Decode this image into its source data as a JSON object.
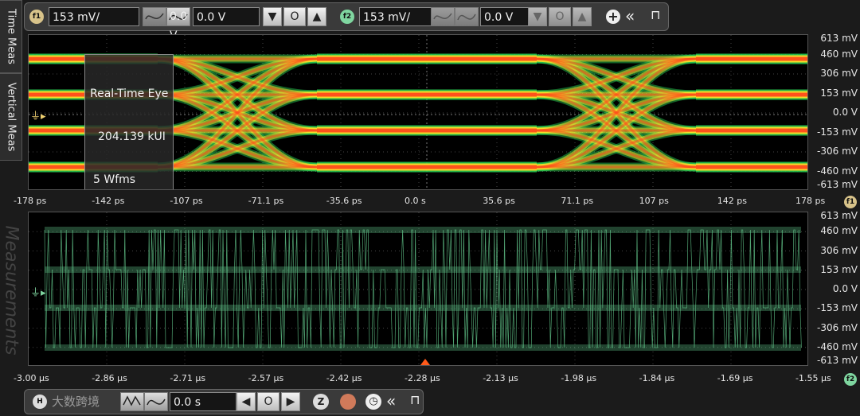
{
  "side_tabs": {
    "time_meas": "Time Meas",
    "vertical_meas": "Vertical Meas",
    "measurements": "Measurements"
  },
  "toolbar": {
    "f1": {
      "badge": "f1",
      "scale": "153 mV/",
      "offset": "0.0 V"
    },
    "f2": {
      "badge": "f2",
      "scale": "153 mV/",
      "offset": "0.0 V"
    },
    "add_icon": "plus-circle-icon",
    "collapse_icon": "double-chevron-left-icon",
    "pin_icon": "pin-icon"
  },
  "eye": {
    "overlay_title": "Real-Time Eye",
    "overlay_rate": "204.139 kUI",
    "overlay_wfms": "5 Wfms",
    "x_ticks": [
      "-178 ps",
      "-142 ps",
      "-107 ps",
      "-71.1 ps",
      "-35.6 ps",
      "0.0 s",
      "35.6 ps",
      "71.1 ps",
      "107 ps",
      "142 ps",
      "178 ps"
    ],
    "y_ticks": [
      "613 mV",
      "460 mV",
      "306 mV",
      "153 mV",
      "0.0 V",
      "-153 mV",
      "-306 mV",
      "-460 mV",
      "-613 mV"
    ],
    "axis_badge": "f1"
  },
  "waveform": {
    "x_ticks": [
      "-3.00 µs",
      "-2.86 µs",
      "-2.71 µs",
      "-2.57 µs",
      "-2.42 µs",
      "-2.28 µs",
      "-2.13 µs",
      "-1.98 µs",
      "-1.84 µs",
      "-1.69 µs",
      "-1.55 µs"
    ],
    "y_ticks": [
      "613 mV",
      "460 mV",
      "306 mV",
      "153 mV",
      "0.0 V",
      "-153 mV",
      "-306 mV",
      "-460 mV",
      "-613 mV"
    ],
    "axis_badge": "f2",
    "trace_color": "#5fbf86"
  },
  "horizontal": {
    "badge": "H",
    "delay": "0.0 s"
  },
  "watermark": "大数跨境",
  "colors": {
    "eye_hot": "#ff3a1a",
    "eye_mid": "#ffe028",
    "eye_cool": "#28c850",
    "trace": "#5fbf86"
  }
}
